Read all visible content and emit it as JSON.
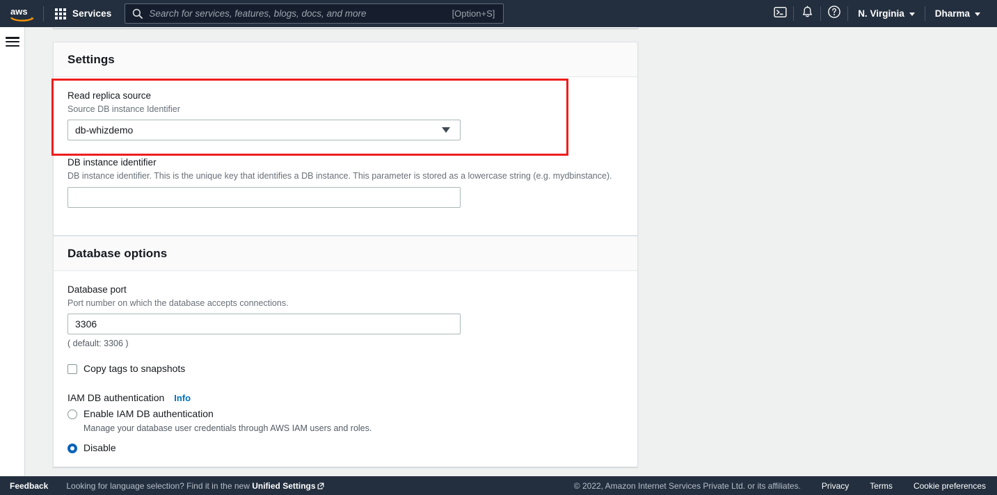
{
  "topnav": {
    "logo_alt": "aws",
    "services_label": "Services",
    "search_placeholder": "Search for services, features, blogs, docs, and more",
    "search_value": "",
    "search_shortcut": "[Option+S]",
    "cloudshell_icon": "terminal-icon",
    "notifications_icon": "bell-icon",
    "help_icon": "question-circle-icon",
    "region_label": "N. Virginia",
    "account_label": "Dharma"
  },
  "sidebar": {
    "toggle_icon": "hamburger-menu-icon"
  },
  "settings_card": {
    "title": "Settings",
    "read_replica": {
      "label": "Read replica source",
      "description": "Source DB instance Identifier",
      "selected_value": "db-whizdemo",
      "options": [
        "db-whizdemo"
      ]
    },
    "db_instance_identifier": {
      "label": "DB instance identifier",
      "description": "DB instance identifier. This is the unique key that identifies a DB instance. This parameter is stored as a lowercase string (e.g. mydbinstance).",
      "value": "",
      "placeholder": ""
    }
  },
  "database_options_card": {
    "title": "Database options",
    "database_port": {
      "label": "Database port",
      "description": "Port number on which the database accepts connections.",
      "value": "3306",
      "hint": "( default: 3306 )"
    },
    "copy_tags": {
      "label": "Copy tags to snapshots",
      "checked": false
    },
    "iam_auth": {
      "group_label": "IAM DB authentication",
      "info_label": "Info",
      "options": [
        {
          "label": "Enable IAM DB authentication",
          "description": "Manage your database user credentials through AWS IAM users and roles.",
          "selected": false
        },
        {
          "label": "Disable",
          "description": "",
          "selected": true
        }
      ]
    }
  },
  "highlight": {
    "color": "#ee1d1d",
    "target": "read-replica-source-field"
  },
  "footer": {
    "feedback_label": "Feedback",
    "language_text": "Looking for language selection? Find it in the new",
    "language_link": "Unified Settings",
    "external_icon": "external-link-icon",
    "copyright": "© 2022, Amazon Internet Services Private Ltd. or its affiliates.",
    "privacy_label": "Privacy",
    "terms_label": "Terms",
    "cookie_label": "Cookie preferences"
  }
}
